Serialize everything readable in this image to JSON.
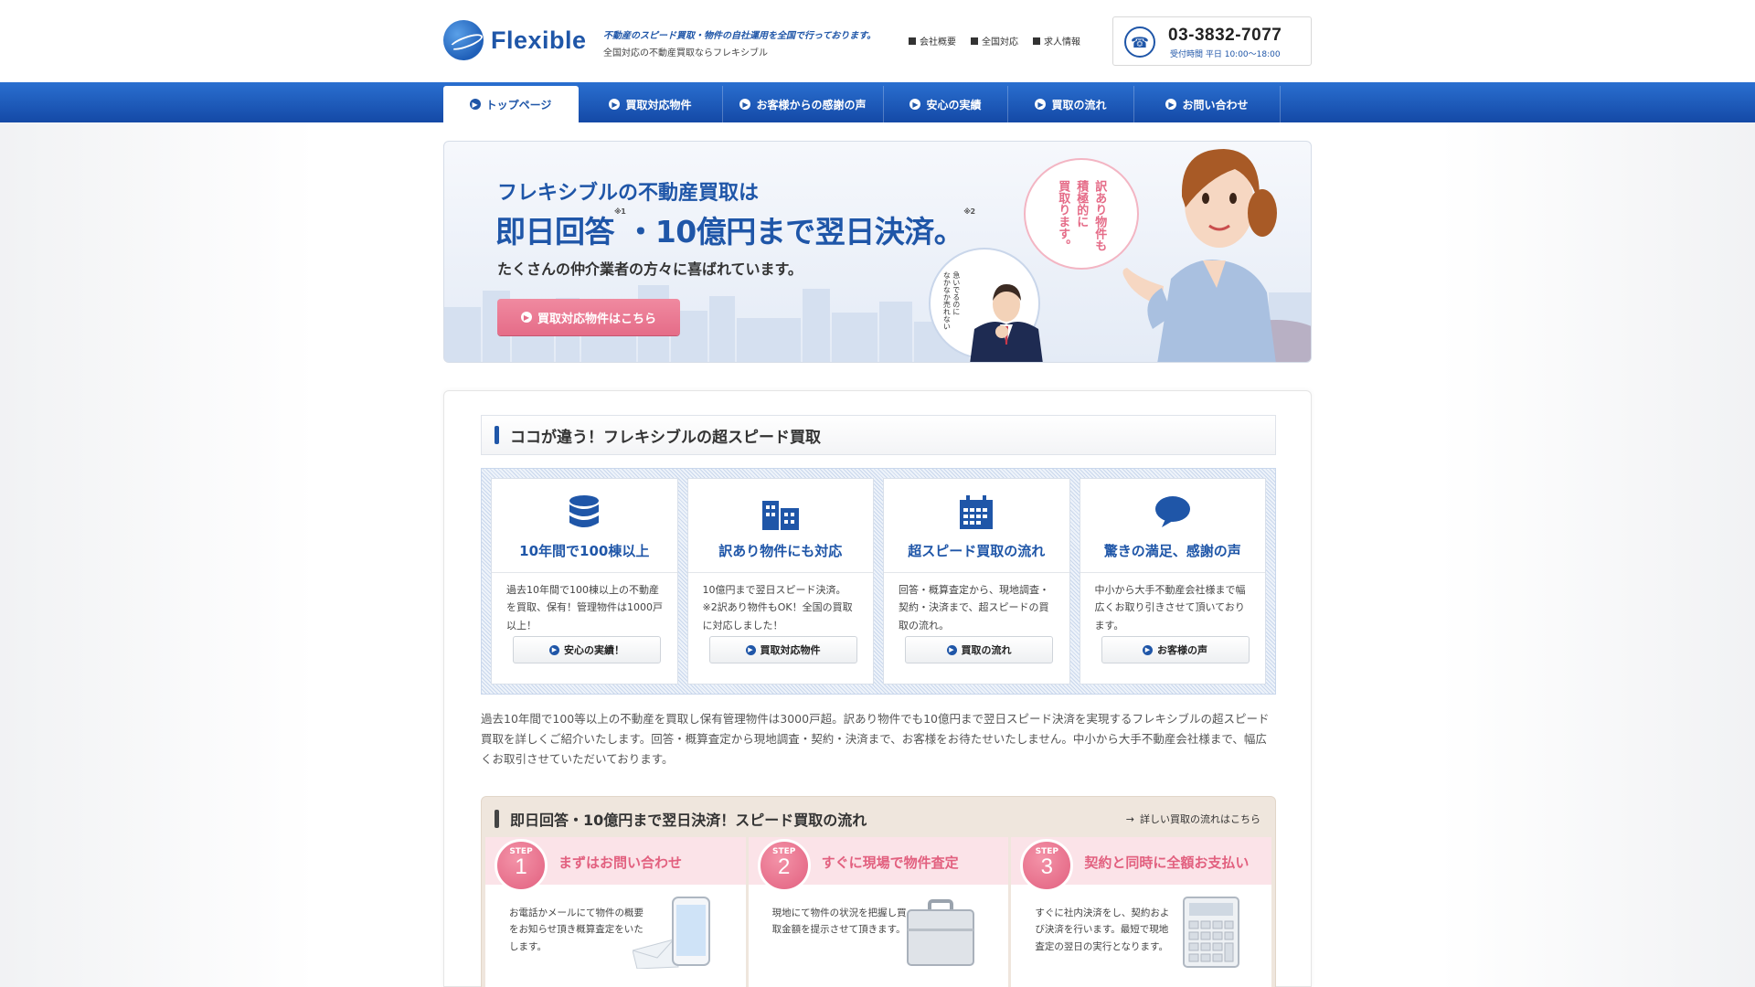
{
  "header": {
    "logo_text": "Flexible",
    "tagline_1": "不動産のスピード買取・物件の自社運用を全国で行っております。",
    "tagline_2": "全国対応の不動産買取ならフレキシブル",
    "util_links": [
      "会社概要",
      "全国対応",
      "求人情報"
    ],
    "tel_number": "03-3832-7077",
    "tel_hours": "受付時間 平日 10:00～18:00"
  },
  "nav": {
    "items": [
      "トップページ",
      "買取対応物件",
      "お客様からの感謝の声",
      "安心の実績",
      "買取の流れ",
      "お問い合わせ"
    ],
    "active_index": 0
  },
  "hero": {
    "line1": "フレキシブルの不動産買取は",
    "line2_a": "即日回答",
    "line2_note1": "※1",
    "line2_b": "・10億円まで翌日決済。",
    "line2_note2": "※2",
    "line3": "たくさんの仲介業者の方々に喜ばれています。",
    "button_label": "買取対応物件はこちら",
    "woman_bubble": [
      "訳あり物件も",
      "積極的に",
      "買取ります。"
    ],
    "man_bubble": [
      "急いでるのに",
      "なかなか売れない"
    ]
  },
  "speed_section": {
    "title": "ココが違う！フレキシブルの超スピード買取",
    "features": [
      {
        "icon": "database-icon",
        "title": "10年間で100棟以上",
        "desc": "過去10年間で100棟以上の不動産を買取、保有！管理物件は1000戸以上！",
        "button": "安心の実績！"
      },
      {
        "icon": "building-icon",
        "title": "訳あり物件にも対応",
        "desc": "10億円まで翌日スピード決済。※2訳あり物件もOK！全国の買取に対応しました！",
        "button": "買取対応物件"
      },
      {
        "icon": "calendar-icon",
        "title": "超スピード買取の流れ",
        "desc": "回答・概算査定から、現地調査・契約・決済まで、超スピードの買取の流れ。",
        "button": "買取の流れ"
      },
      {
        "icon": "speech-bubble-icon",
        "title": "驚きの満足、感謝の声",
        "desc": "中小から大手不動産会社様まで幅広くお取り引きさせて頂いております。",
        "button": "お客様の声"
      }
    ],
    "intro": "過去10年間で100等以上の不動産を買取し保有管理物件は3000戸超。訳あり物件でも10億円まで翌日スピード決済を実現するフレキシブルの超スピード買取を詳しくご紹介いたします。回答・概算査定から現地調査・契約・決済まで、お客様をお待たせいたしません。中小から大手不動産会社様まで、幅広くお取引させていただいております。"
  },
  "flow_section": {
    "title": "即日回答・10億円まで翌日決済！スピード買取の流れ",
    "link": "詳しい買取の流れはこちら",
    "step_label": "STEP",
    "steps": [
      {
        "num": "1",
        "title": "まずはお問い合わせ",
        "desc": "お電話かメールにて物件の概要をお知らせ頂き概算査定をいたします。",
        "icon": "phone-mail-icon"
      },
      {
        "num": "2",
        "title": "すぐに現場で物件査定",
        "desc": "現地にて物件の状況を把握し買取金額を提示させて頂きます。",
        "icon": "briefcase-icon"
      },
      {
        "num": "3",
        "title": "契約と同時に全額お支払い",
        "desc": "すぐに社内決済をし、契約および決済を行います。最短で現地査定の翌日の実行となります。",
        "icon": "calculator-icon"
      }
    ]
  },
  "colors": {
    "brand_blue": "#1f56a8",
    "accent_pink": "#e56c88"
  }
}
